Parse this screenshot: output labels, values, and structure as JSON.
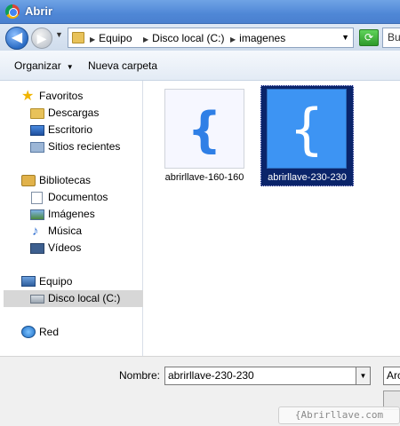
{
  "window": {
    "title": "Abrir"
  },
  "address": {
    "crumbs": [
      "Equipo",
      "Disco local (C:)",
      "imagenes"
    ],
    "search_placeholder": "Bu"
  },
  "toolbar": {
    "organize_label": "Organizar",
    "new_folder_label": "Nueva carpeta"
  },
  "sidebar": {
    "favorites": {
      "label": "Favoritos",
      "items": [
        "Descargas",
        "Escritorio",
        "Sitios recientes"
      ]
    },
    "libraries": {
      "label": "Bibliotecas",
      "items": [
        "Documentos",
        "Imágenes",
        "Música",
        "Vídeos"
      ]
    },
    "computer": {
      "label": "Equipo",
      "items": [
        "Disco local (C:)"
      ]
    },
    "network": {
      "label": "Red"
    },
    "selected_item": "Disco local (C:)"
  },
  "files": [
    {
      "name": "abrirllave-160-160",
      "selected": false,
      "glyph": "{"
    },
    {
      "name": "abrirllave-230-230",
      "selected": true,
      "glyph": "{"
    }
  ],
  "bottom": {
    "filename_label": "Nombre:",
    "filename_value": "abrirllave-230-230",
    "filetype_value": "Arc"
  },
  "watermark": "{Abrirllave.com",
  "colors": {
    "selection": "#0a246a",
    "file_icon_blue": "#2f7fe6"
  }
}
